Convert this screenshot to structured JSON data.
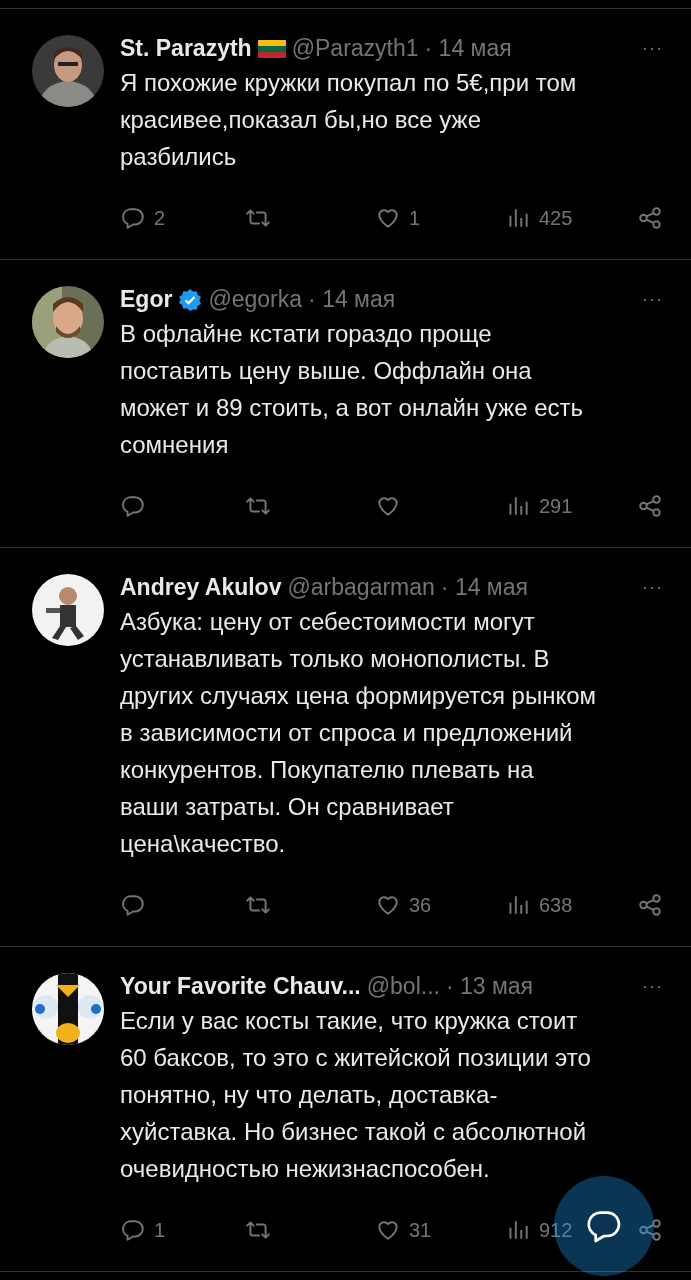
{
  "tweets": [
    {
      "name": "St. Parazyth",
      "verified": false,
      "flag": true,
      "handle": "@Parazyth1",
      "date": "· 14 мая",
      "more": "···",
      "text_lines": [
        "Я похожие кружки покупал по 5€,при том",
        "красивее,показал бы,но все уже",
        "разбились"
      ],
      "replies": "2",
      "likes": "1",
      "views": "425"
    },
    {
      "name": "Egor",
      "verified": true,
      "flag": false,
      "handle": "@egorka",
      "date": "· 14 мая",
      "more": "···",
      "text_lines": [
        "В офлайне кстати гораздо проще",
        "поставить цену выше. Оффлайн она",
        "может и 89 стоить, а вот онлайн уже есть",
        "сомнения"
      ],
      "views": "291"
    },
    {
      "name": "Andrey Akulov",
      "verified": false,
      "flag": false,
      "handle": "@arbagarman",
      "date": "· 14 мая",
      "more": "···",
      "text_lines": [
        "Азбука: цену от себестоимости могут",
        "устанавливать только монополисты. В",
        "других случаях цена формируется рынком",
        "в зависимости от спроса и предложений",
        "конкурентов. Покупателю плевать на",
        "ваши затраты. Он сравнивает",
        "цена\\качество."
      ],
      "likes": "36",
      "views": "638"
    },
    {
      "name": "Your Favorite Chauv...",
      "verified": false,
      "flag": false,
      "handle": "@bol...",
      "date": "· 13 мая",
      "more": "···",
      "text_lines": [
        "Если у вас косты такие, что кружка стоит",
        "60 баксов, то это с житейской позиции это",
        "понятно, ну что делать, доставка-",
        "хуйставка. Но бизнес такой с абсолютной",
        "очевидностью нежизнаспособен."
      ],
      "replies": "1",
      "likes": "31",
      "views": "912"
    }
  ]
}
